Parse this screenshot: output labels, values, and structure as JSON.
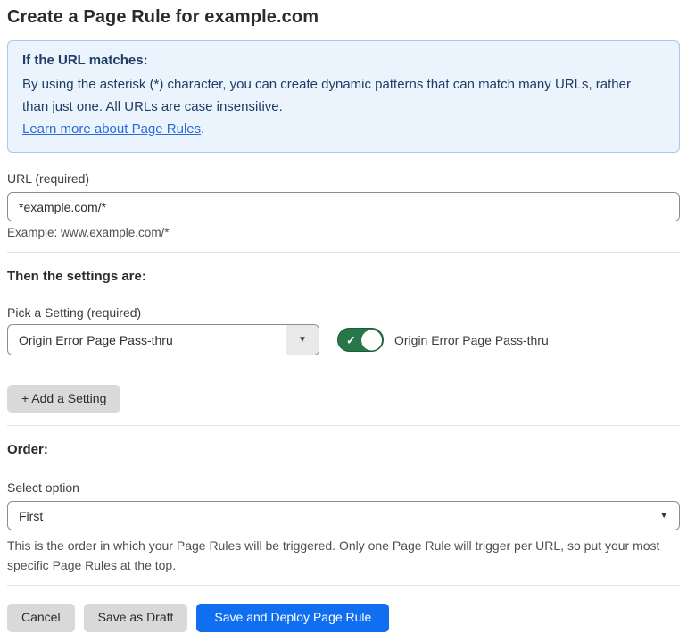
{
  "page": {
    "title": "Create a Page Rule for example.com"
  },
  "info_box": {
    "heading": "If the URL matches:",
    "body": "By using the asterisk (*) character, you can create dynamic patterns that can match many URLs, rather than just one. All URLs are case insensitive.",
    "link_label": "Learn more about Page Rules",
    "link_suffix": "."
  },
  "url_section": {
    "label": "URL (required)",
    "value": "*example.com/*",
    "helper": "Example: www.example.com/*"
  },
  "settings_section": {
    "heading": "Then the settings are:",
    "picker_label": "Pick a Setting (required)",
    "picker_value": "Origin Error Page Pass-thru",
    "toggle_state": "on",
    "toggle_label": "Origin Error Page Pass-thru",
    "add_button_label": "+ Add a Setting"
  },
  "order_section": {
    "heading": "Order:",
    "select_label": "Select option",
    "select_value": "First",
    "helper": "This is the order in which your Page Rules will be triggered. Only one Page Rule will trigger per URL, so put your most specific Page Rules at the top."
  },
  "footer": {
    "cancel_label": "Cancel",
    "save_draft_label": "Save as Draft",
    "save_deploy_label": "Save and Deploy Page Rule"
  },
  "icons": {
    "caret_down": "▼",
    "check": "✓"
  },
  "colors": {
    "accent_blue": "#106ef0",
    "toggle_green": "#26784a",
    "info_background": "#ebf3fc",
    "info_border": "#a9c9ea",
    "info_text": "#1e3c66",
    "link_blue": "#2b6cd9",
    "button_gray": "#d9d9d9"
  }
}
